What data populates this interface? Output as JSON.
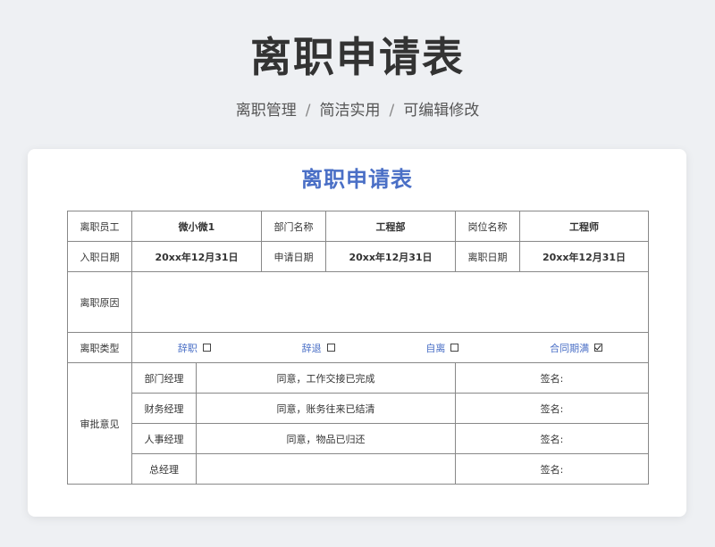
{
  "header": {
    "title": "离职申请表",
    "subtitle_parts": [
      "离职管理",
      "简洁实用",
      "可编辑修改"
    ],
    "separator": "/"
  },
  "form": {
    "title": "离职申请表",
    "row1": {
      "employee_label": "离职员工",
      "employee_value": "微小微1",
      "dept_label": "部门名称",
      "dept_value": "工程部",
      "post_label": "岗位名称",
      "post_value": "工程师"
    },
    "row2": {
      "entry_label": "入职日期",
      "entry_value": "20xx年12月31日",
      "apply_label": "申请日期",
      "apply_value": "20xx年12月31日",
      "leave_label": "离职日期",
      "leave_value": "20xx年12月31日"
    },
    "reason_label": "离职原因",
    "type_label": "离职类型",
    "types": [
      {
        "label": "辞职",
        "checked": false
      },
      {
        "label": "辞退",
        "checked": false
      },
      {
        "label": "自离",
        "checked": false
      },
      {
        "label": "合同期满",
        "checked": true
      }
    ],
    "approval_label": "审批意见",
    "approvals": [
      {
        "role": "部门经理",
        "opinion": "同意，工作交接已完成",
        "sign": "签名:"
      },
      {
        "role": "财务经理",
        "opinion": "同意，账务往来已结清",
        "sign": "签名:"
      },
      {
        "role": "人事经理",
        "opinion": "同意，物品已归还",
        "sign": "签名:"
      },
      {
        "role": "总经理",
        "opinion": "",
        "sign": "签名:"
      }
    ]
  }
}
